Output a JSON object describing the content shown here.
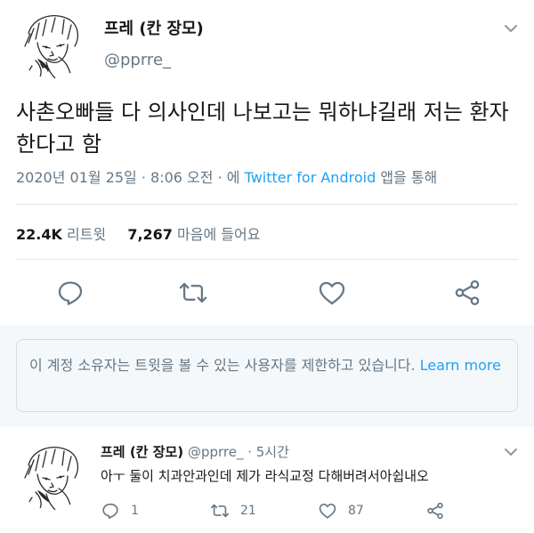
{
  "tweet": {
    "display_name": "프레 (칸 장모)",
    "handle": "@pprre_",
    "text": "사촌오빠들 다 의사인데 나보고는 뭐하냐길래 저는 환자한다고 함",
    "timestamp": "2020년 01월 25일 · 8:06 오전 · 에",
    "via_app": "Twitter for Android",
    "via_suffix": "앱을 통해",
    "retweets_count": "22.4K",
    "retweets_label": "리트윗",
    "likes_count": "7,267",
    "likes_label": "마음에 들어요"
  },
  "notice": {
    "text": "이 계정 소유자는 트윗을 볼 수 있는 사용자를 제한하고 있습니다.",
    "link": "Learn more"
  },
  "reply": {
    "display_name": "프레 (칸 장모)",
    "handle_time": "@pprre_ · 5시간",
    "text": "아ㅜ 둘이 치과안과인데 제가 라식교정 다해버려서아쉽내오",
    "reply_count": "1",
    "retweet_count": "21",
    "like_count": "87"
  },
  "icons": {
    "reply": "comment-icon",
    "retweet": "retweet-icon",
    "like": "heart-icon",
    "share": "share-icon",
    "menu": "chevron-down-icon"
  },
  "colors": {
    "accent": "#1da1f2",
    "secondary_text": "#657786",
    "icon": "#657786"
  }
}
